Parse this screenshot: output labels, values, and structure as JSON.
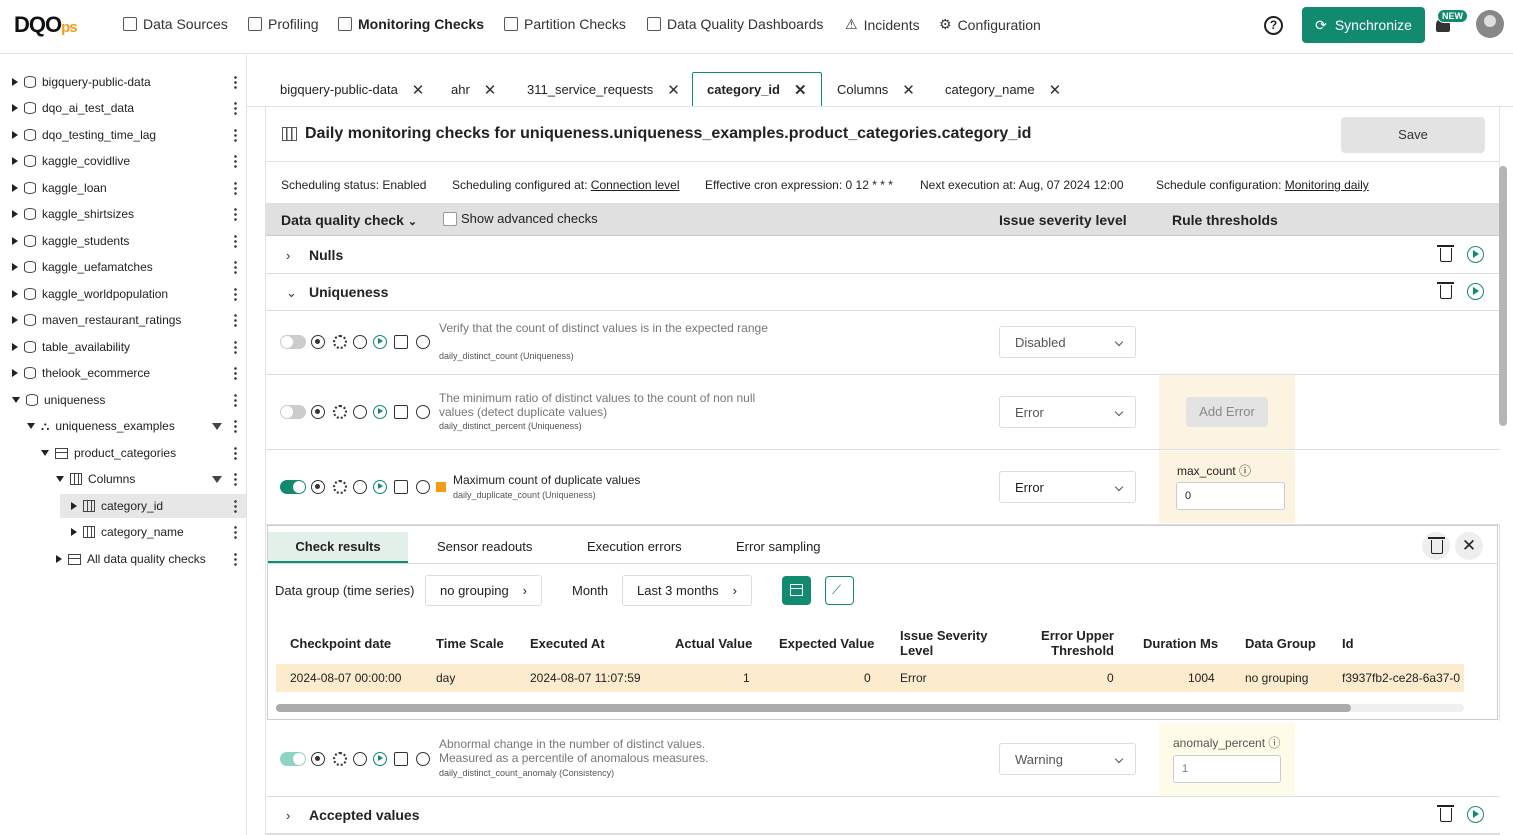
{
  "brand": {
    "logo_main": "DQO",
    "logo_suffix": "ps"
  },
  "nav": [
    "Data Sources",
    "Profiling",
    "Monitoring Checks",
    "Partition Checks",
    "Data Quality Dashboards",
    "Incidents",
    "Configuration"
  ],
  "top_right": {
    "help": "?",
    "sync_label": "Synchronize",
    "new_badge": "NEW"
  },
  "tree": [
    {
      "label": "bigquery-public-data"
    },
    {
      "label": "dqo_ai_test_data"
    },
    {
      "label": "dqo_testing_time_lag"
    },
    {
      "label": "kaggle_covidlive"
    },
    {
      "label": "kaggle_loan"
    },
    {
      "label": "kaggle_shirtsizes"
    },
    {
      "label": "kaggle_students"
    },
    {
      "label": "kaggle_uefamatches"
    },
    {
      "label": "kaggle_worldpopulation"
    },
    {
      "label": "maven_restaurant_ratings"
    },
    {
      "label": "table_availability"
    },
    {
      "label": "thelook_ecommerce"
    },
    {
      "label": "uniqueness"
    },
    {
      "label": "uniqueness_examples"
    },
    {
      "label": "product_categories"
    },
    {
      "label": "Columns"
    },
    {
      "label": "category_id"
    },
    {
      "label": "category_name"
    },
    {
      "label": "All data quality checks"
    }
  ],
  "tabs": [
    "bigquery-public-data",
    "ahr",
    "311_service_requests",
    "category_id",
    "Columns",
    "category_name"
  ],
  "title": "Daily monitoring checks for uniqueness.uniqueness_examples.product_categories.category_id",
  "save_label": "Save",
  "schedule": {
    "status_label": "Scheduling status:",
    "status": "Enabled",
    "configured_label": "Scheduling configured at:",
    "configured": "Connection level",
    "cron_label": "Effective cron expression:",
    "cron": "0 12 * * *",
    "next_label": "Next execution at:",
    "next": "Aug, 07 2024 12:00",
    "config_label": "Schedule configuration:",
    "config": "Monitoring daily"
  },
  "table_header": {
    "check": "Data quality check",
    "advanced": "Show advanced checks",
    "severity": "Issue severity level",
    "thresholds": "Rule thresholds"
  },
  "groups": {
    "nulls": "Nulls",
    "uniqueness": "Uniqueness",
    "accepted": "Accepted values"
  },
  "checks": [
    {
      "desc": "Verify that the count of distinct values is in the expected range",
      "name": "daily_distinct_count (Uniqueness)",
      "severity": "Disabled"
    },
    {
      "desc": "The minimum ratio of distinct values to the count of non null values (detect duplicate values)",
      "name": "daily_distinct_percent (Uniqueness)",
      "severity": "Error",
      "add_label": "Add Error"
    },
    {
      "desc": "Maximum count of duplicate values",
      "name": "daily_duplicate_count (Uniqueness)",
      "severity": "Error",
      "param": "max_count",
      "param_value": "0"
    },
    {
      "desc": "Abnormal change in the number of distinct values. Measured as a percentile of anomalous measures.",
      "name": "daily_distinct_count_anomaly (Consistency)",
      "severity": "Warning",
      "param": "anomaly_percent",
      "param_value": "1"
    }
  ],
  "results": {
    "tabs": [
      "Check results",
      "Sensor readouts",
      "Execution errors",
      "Error sampling"
    ],
    "group_label": "Data group (time series)",
    "group_value": "no grouping",
    "month_label": "Month",
    "month_value": "Last 3 months",
    "columns": [
      "Checkpoint date",
      "Time Scale",
      "Executed At",
      "Actual Value",
      "Expected Value",
      "Issue Severity Level",
      "Error Upper Threshold",
      "Duration Ms",
      "Data Group",
      "Id"
    ],
    "row": [
      "2024-08-07 00:00:00",
      "day",
      "2024-08-07 11:07:59",
      "1",
      "0",
      "Error",
      "0",
      "1004",
      "no grouping",
      "f3937fb2-ce28-6a37-0"
    ]
  }
}
